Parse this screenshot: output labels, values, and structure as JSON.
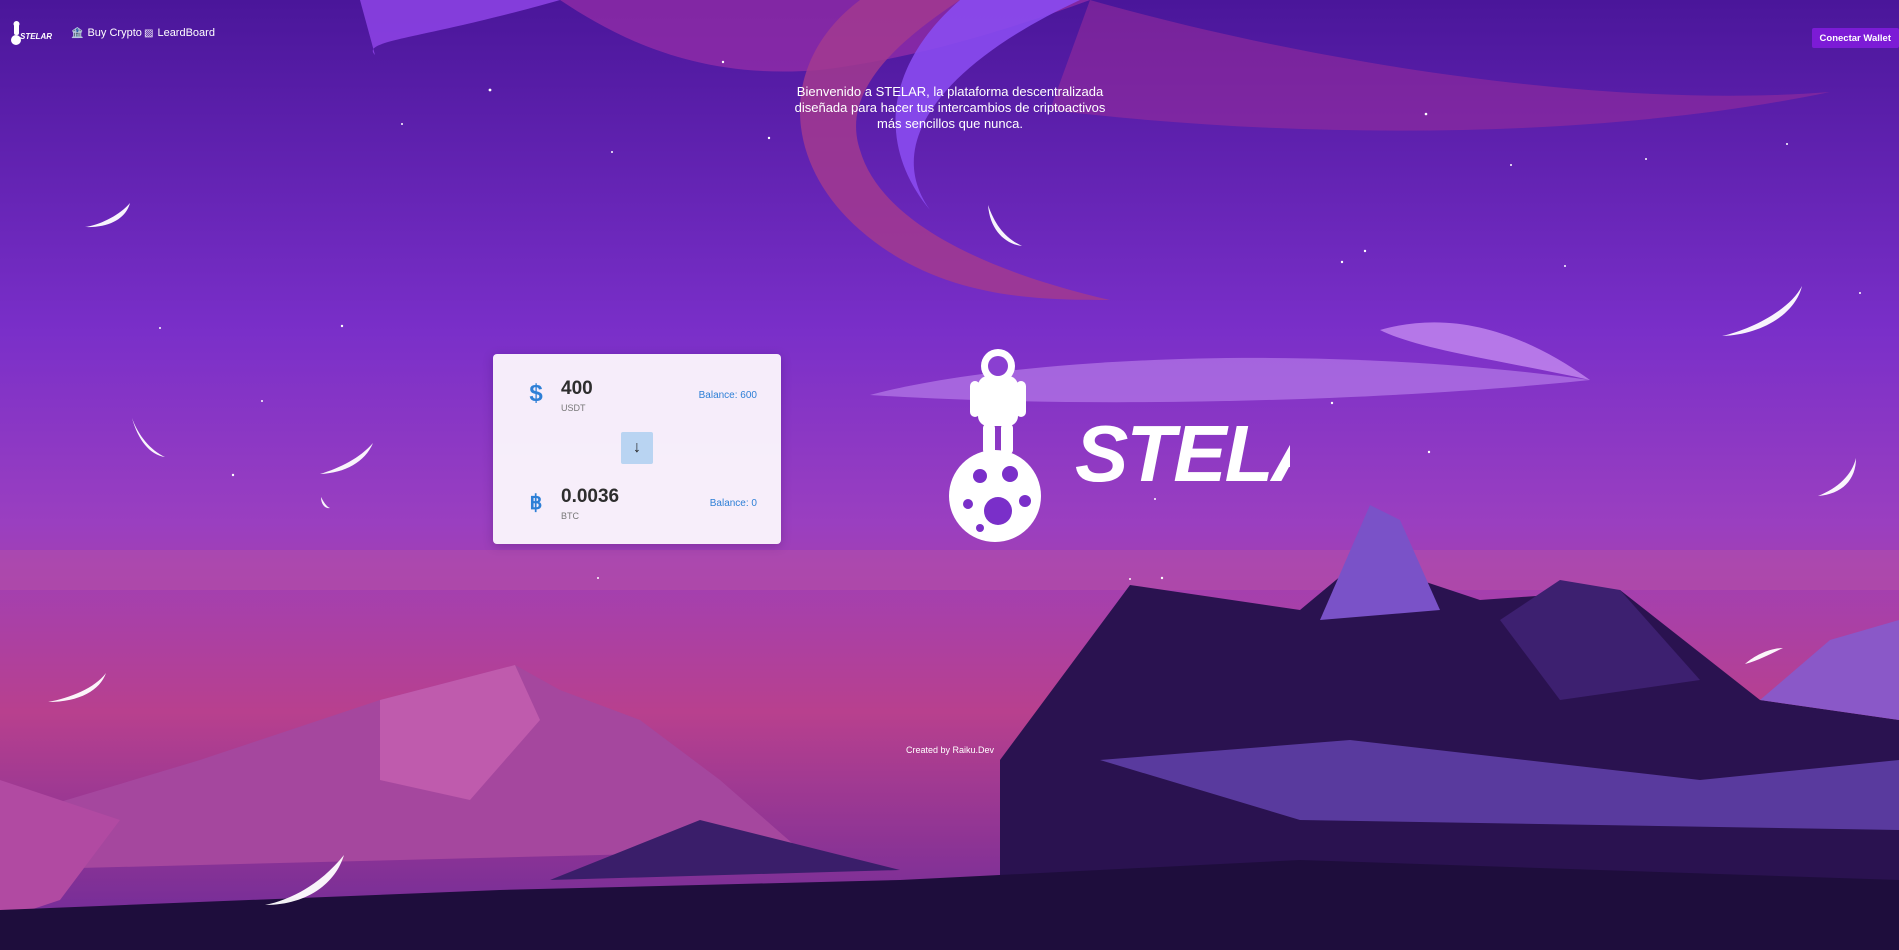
{
  "nav": {
    "buy_crypto": "Buy Crypto",
    "leaderboard": "LeardBoard",
    "connect_wallet": "Conectar Wallet"
  },
  "welcome": {
    "line1": "Bienvenido a STELAR, la plataforma descentralizada",
    "line2": "diseñada para hacer tus intercambios de criptoactivos",
    "line3": "más sencillos que nunca."
  },
  "swap": {
    "from": {
      "amount": "400",
      "token": "USDT",
      "balance": "Balance: 600",
      "icon": "dollar-icon"
    },
    "to": {
      "amount": "0.0036",
      "token": "BTC",
      "balance": "Balance: 0",
      "icon": "bitcoin-icon"
    },
    "swap_icon": "arrow-down-icon"
  },
  "brand": {
    "name": "STELAR"
  },
  "footer": {
    "credit": "Created by Raiku.Dev"
  },
  "colors": {
    "sky_top": "#4a1a9e",
    "sky_mid": "#8a3fd1",
    "horizon": "#b23b8a",
    "accent_blue": "#2d7fd6",
    "button_purple": "#7c1bd6"
  }
}
